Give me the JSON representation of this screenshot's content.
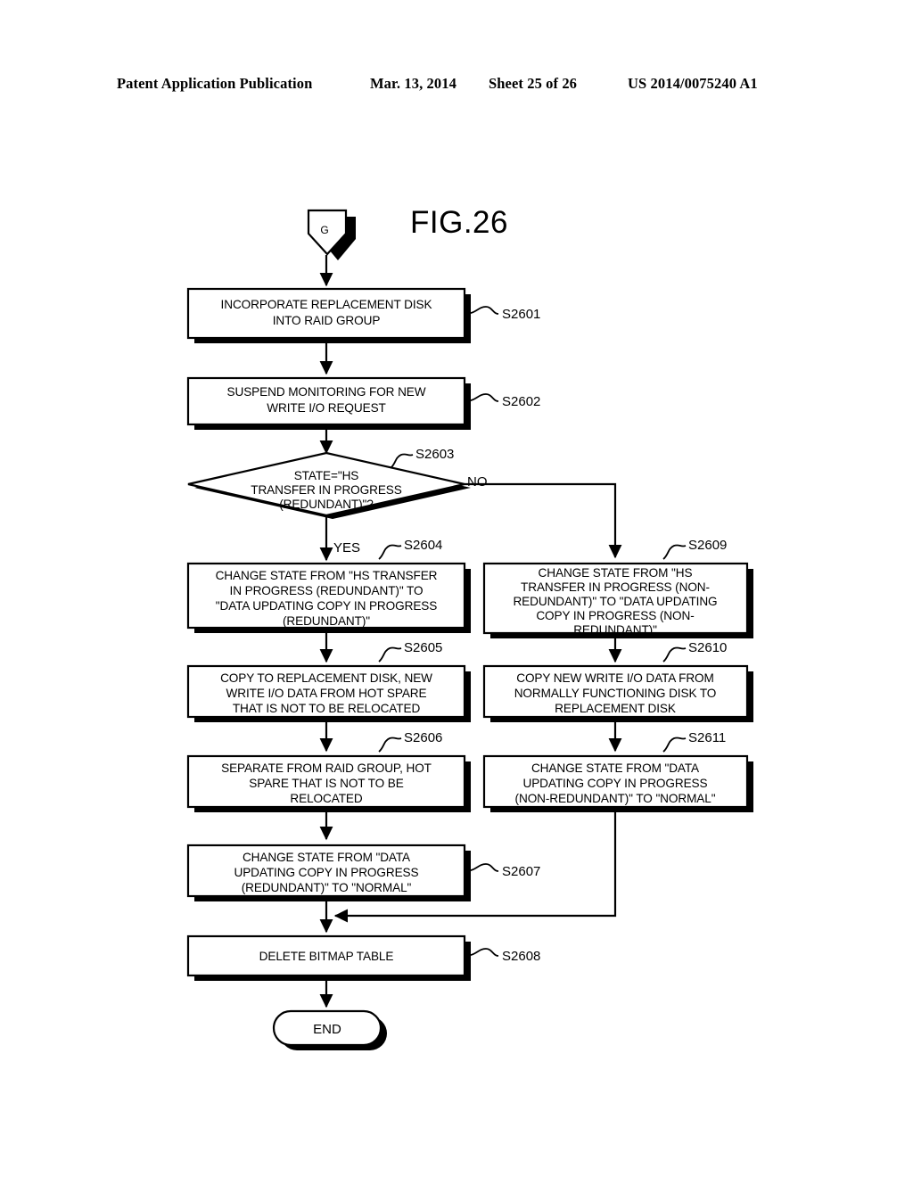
{
  "header": {
    "publication": "Patent Application Publication",
    "date": "Mar. 13, 2014",
    "sheet": "Sheet 25 of 26",
    "patent_number": "US 2014/0075240 A1"
  },
  "figure": {
    "title": "FIG.26",
    "connector_in": "G",
    "terminator_end": "END"
  },
  "branch_labels": {
    "yes": "YES",
    "no": "NO"
  },
  "nodes": [
    {
      "id": "S2601",
      "label": "S2601",
      "lines": [
        "INCORPORATE REPLACEMENT DISK",
        "INTO RAID GROUP"
      ]
    },
    {
      "id": "S2602",
      "label": "S2602",
      "lines": [
        "SUSPEND MONITORING FOR NEW",
        "WRITE I/O REQUEST"
      ]
    },
    {
      "id": "S2603",
      "label": "S2603",
      "lines": [
        "STATE=\"HS",
        "TRANSFER IN PROGRESS",
        "(REDUNDANT)\"?"
      ]
    },
    {
      "id": "S2604",
      "label": "S2604",
      "lines": [
        "CHANGE STATE FROM \"HS TRANSFER",
        "IN PROGRESS (REDUNDANT)\" TO",
        "\"DATA UPDATING COPY IN PROGRESS",
        "(REDUNDANT)\""
      ]
    },
    {
      "id": "S2605",
      "label": "S2605",
      "lines": [
        "COPY TO REPLACEMENT DISK, NEW",
        "WRITE I/O DATA FROM HOT SPARE",
        "THAT IS NOT TO BE RELOCATED"
      ]
    },
    {
      "id": "S2606",
      "label": "S2606",
      "lines": [
        "SEPARATE FROM RAID GROUP, HOT",
        "SPARE THAT IS NOT TO BE",
        "RELOCATED"
      ]
    },
    {
      "id": "S2607",
      "label": "S2607",
      "lines": [
        "CHANGE STATE FROM \"DATA",
        "UPDATING COPY IN PROGRESS",
        "(REDUNDANT)\" TO \"NORMAL\""
      ]
    },
    {
      "id": "S2608",
      "label": "S2608",
      "lines": [
        "DELETE BITMAP TABLE"
      ]
    },
    {
      "id": "S2609",
      "label": "S2609",
      "lines": [
        "CHANGE STATE FROM \"HS",
        "TRANSFER IN PROGRESS (NON-",
        "REDUNDANT)\" TO \"DATA UPDATING",
        "COPY IN PROGRESS (NON-",
        "REDUNDANT)\""
      ]
    },
    {
      "id": "S2610",
      "label": "S2610",
      "lines": [
        "COPY NEW WRITE I/O DATA FROM",
        "NORMALLY FUNCTIONING DISK TO",
        "REPLACEMENT DISK"
      ]
    },
    {
      "id": "S2611",
      "label": "S2611",
      "lines": [
        "CHANGE STATE FROM \"DATA",
        "UPDATING COPY IN PROGRESS",
        "(NON-REDUNDANT)\" TO \"NORMAL\""
      ]
    }
  ]
}
